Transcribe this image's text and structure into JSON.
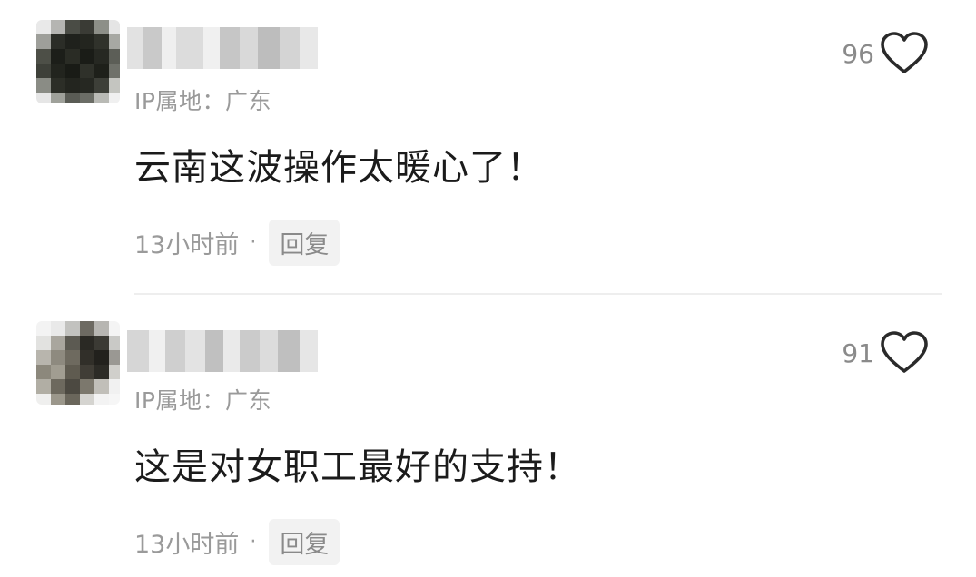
{
  "comments": [
    {
      "ip_label": "IP属地：广东",
      "like_count": "96",
      "content": "云南这波操作太暖心了！",
      "time": "13小时前",
      "dot": "·",
      "reply_label": "回复",
      "avatar_blur": "pixelated",
      "name_blur": "pixelated"
    },
    {
      "ip_label": "IP属地：广东",
      "like_count": "91",
      "content": "这是对女职工最好的支持！",
      "time": "13小时前",
      "dot": "·",
      "reply_label": "回复",
      "avatar_blur": "pixelated",
      "name_blur": "pixelated"
    }
  ],
  "icons": {
    "like": "heart-outline-icon"
  },
  "colors": {
    "meta_text": "#9a9a9a",
    "body_text": "#1b1b1b",
    "reply_bg": "#f2f2f2"
  }
}
